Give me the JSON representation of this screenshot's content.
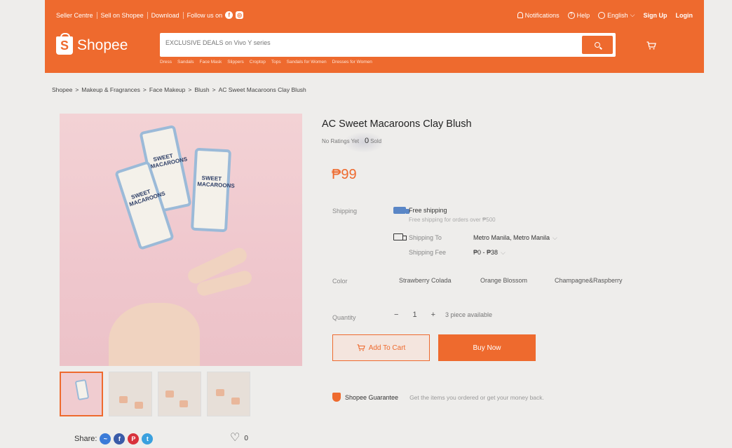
{
  "topbar": {
    "left_links": [
      "Seller Centre",
      "Sell on Shopee",
      "Download",
      "Follow us on"
    ],
    "notifications": "Notifications",
    "help": "Help",
    "language": "English",
    "signup": "Sign Up",
    "login": "Login"
  },
  "brand": {
    "name": "Shopee",
    "color": "#ee6a2e"
  },
  "search": {
    "placeholder": "EXCLUSIVE DEALS on Vivo Y series",
    "suggestions": [
      "Dress",
      "Sandals",
      "Face Mask",
      "Slippers",
      "Croptop",
      "Tops",
      "Sandals for Women",
      "Dresses for Women"
    ]
  },
  "breadcrumb": [
    "Shopee",
    "Makeup & Fragrances",
    "Face Makeup",
    "Blush",
    "AC Sweet Macaroons Clay Blush"
  ],
  "product": {
    "title": "AC Sweet Macaroons Clay Blush",
    "rating_text": "No Ratings Yet",
    "sold_count": "0",
    "sold_label": "Sold",
    "price": "₱99",
    "image_text": "SWEET MACAROONS"
  },
  "shipping": {
    "label": "Shipping",
    "free": "Free shipping",
    "free_note": "Free shipping for orders over ₱500",
    "to_label": "Shipping To",
    "to_value": "Metro Manila, Metro Manila",
    "fee_label": "Shipping Fee",
    "fee_value": "₱0 - ₱38"
  },
  "color": {
    "label": "Color",
    "options": [
      "Strawberry Colada",
      "Orange Blossom",
      "Champagne&Raspberry"
    ]
  },
  "quantity": {
    "label": "Quantity",
    "value": "1",
    "minus": "−",
    "plus": "+",
    "available": "3 piece available"
  },
  "actions": {
    "add_to_cart": "Add To Cart",
    "buy_now": "Buy Now"
  },
  "guarantee": {
    "title": "Shopee Guarantee",
    "desc": "Get the items you ordered or get your money back."
  },
  "share": {
    "label": "Share:",
    "likes": "0"
  }
}
